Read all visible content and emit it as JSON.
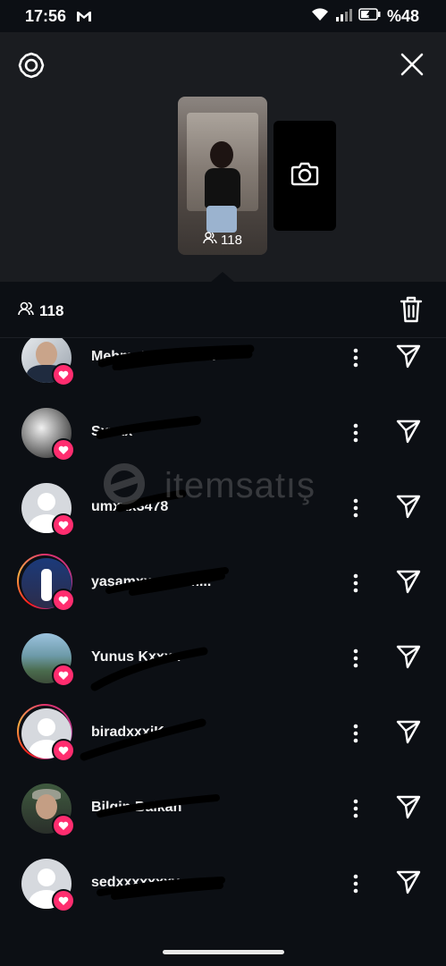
{
  "status_bar": {
    "time": "17:56",
    "battery": "%48"
  },
  "story": {
    "viewer_count": "118"
  },
  "viewers_bar": {
    "count": "118"
  },
  "viewers": [
    {
      "username": "Mehmet Cxxxxxxx"
    },
    {
      "username": "Sxxxx"
    },
    {
      "username": "umxxx3478"
    },
    {
      "username": "yaşamxxxxxzım..."
    },
    {
      "username": "Yunus Kxxxx"
    },
    {
      "username": "biradxxxjK"
    },
    {
      "username": "Bilgin Balkan"
    },
    {
      "username": "sedxxxxxxxy"
    }
  ],
  "watermark": {
    "text": "itemsatış"
  },
  "colors": {
    "background": "#0c0f14",
    "header": "#1a1c20",
    "heart": "#ff2d6f",
    "text": "#f2f2f2"
  }
}
